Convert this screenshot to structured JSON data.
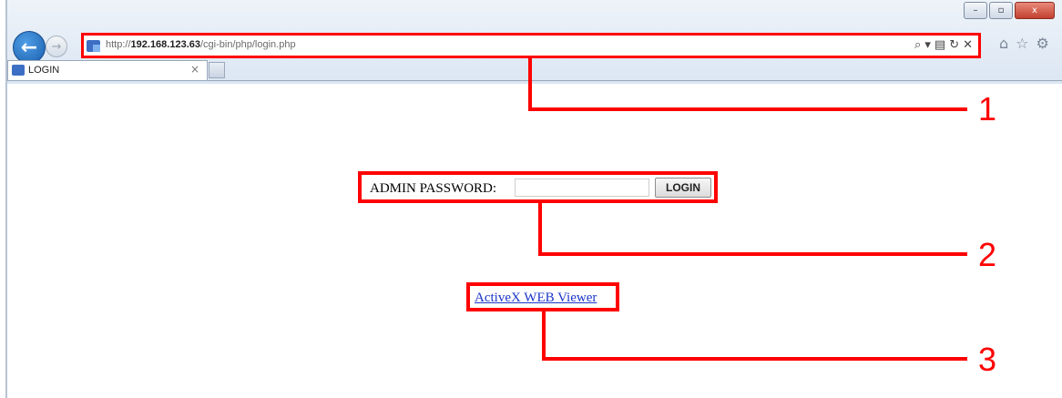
{
  "window": {
    "minimize_icon": "minimize-icon",
    "maximize_icon": "maximize-icon",
    "close_icon": "close-icon",
    "minimize_glyph": "–",
    "maximize_glyph": "▫",
    "close_glyph": "x"
  },
  "navigation": {
    "back_glyph": "←",
    "forward_glyph": "→"
  },
  "address_bar": {
    "url_prefix": "http://",
    "url_host": "192.168.123.63",
    "url_path": "/cgi-bin/php/login.php",
    "search_glyph": "⌕ ▾",
    "compat_glyph": "▤",
    "refresh_glyph": "↻",
    "stop_glyph": "✕"
  },
  "toolbar_icons": {
    "home_glyph": "⌂",
    "favorites_glyph": "☆",
    "tools_glyph": "⚙"
  },
  "tab": {
    "title": "LOGIN",
    "close_glyph": "×"
  },
  "login_form": {
    "label": "ADMIN PASSWORD:",
    "password_value": "",
    "button_label": "LOGIN"
  },
  "links": {
    "viewer_label": "ActiveX WEB Viewer"
  },
  "callouts": [
    "1",
    "2",
    "3"
  ],
  "colors": {
    "highlight": "#ff0000",
    "link": "#1a35c8"
  }
}
